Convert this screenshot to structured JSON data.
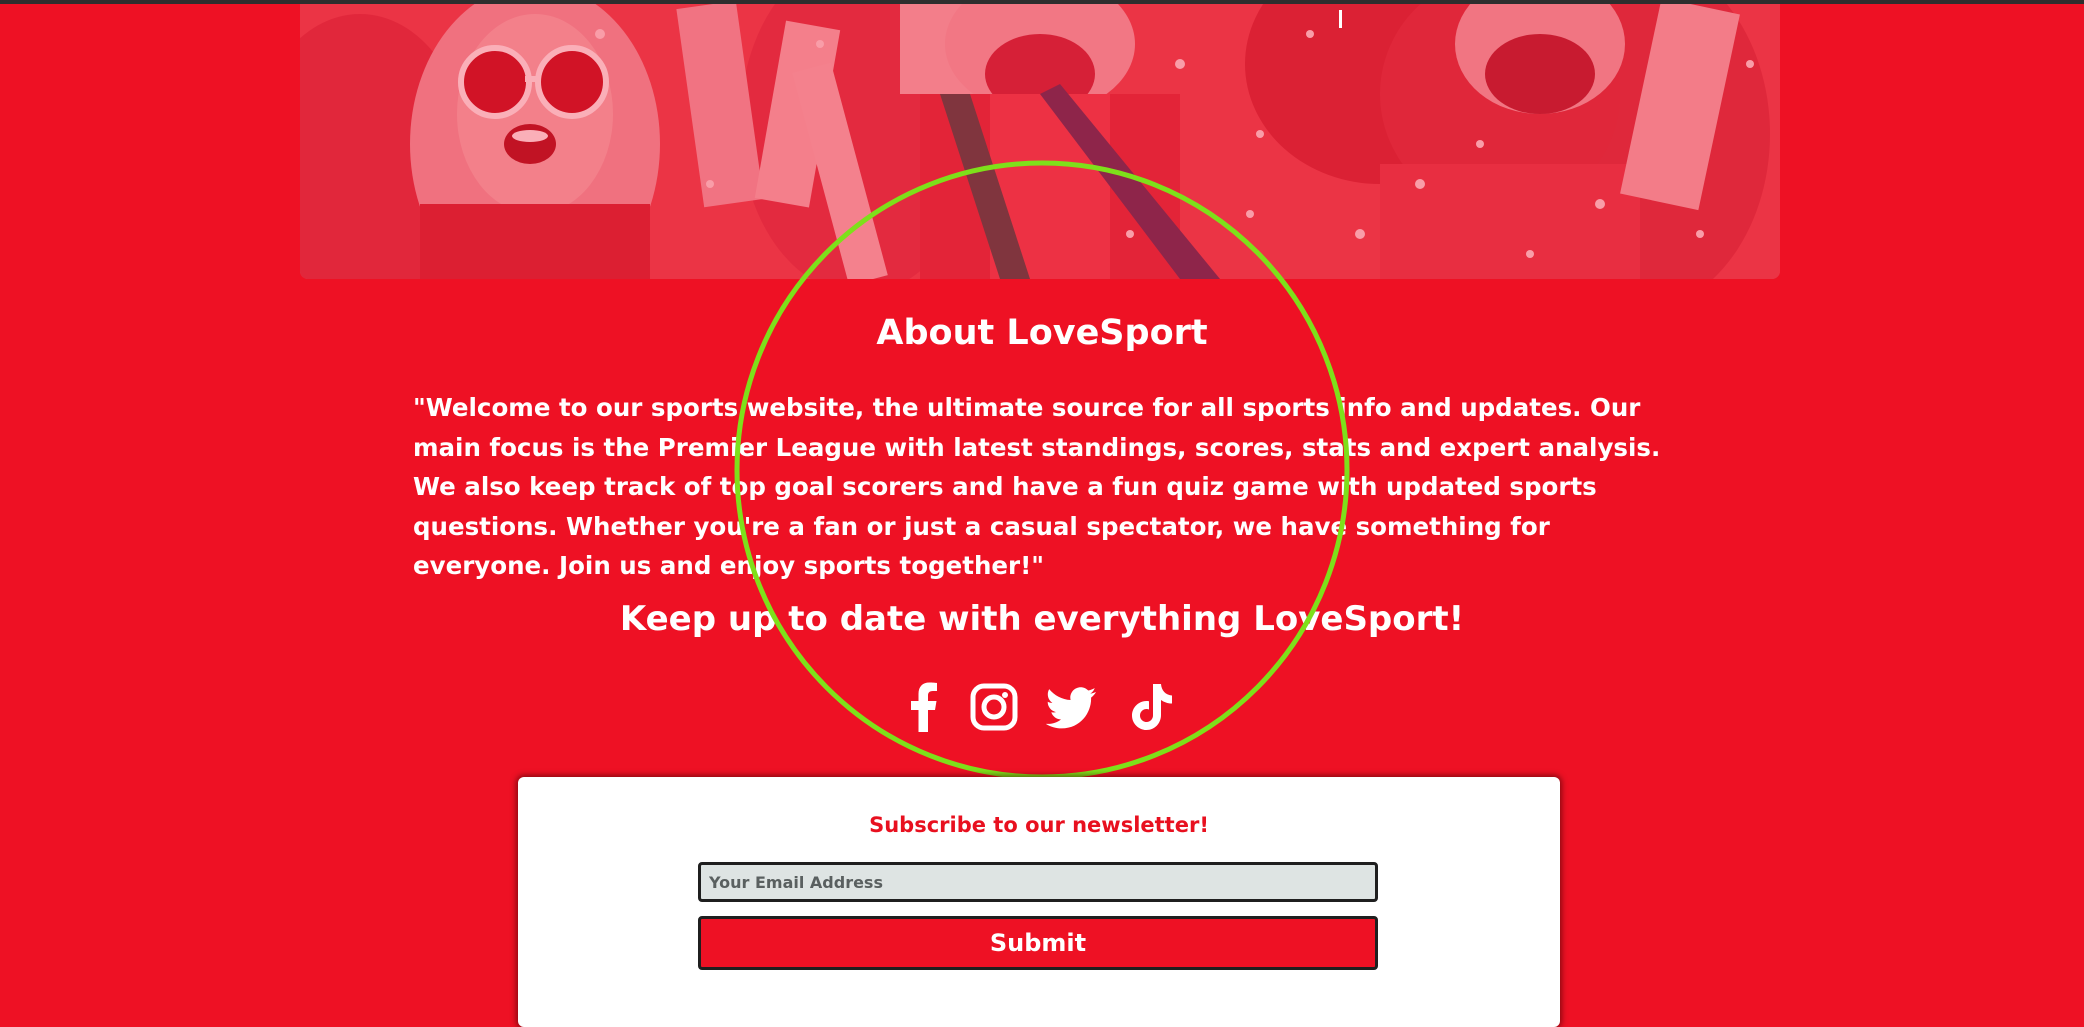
{
  "about": {
    "title": "About LoveSport",
    "description": "\"Welcome to our sports website, the ultimate source for all sports info and updates. Our main focus is the Premier League with latest standings, scores, stats and expert analysis. We also keep track of top goal scorers and have a fun quiz game with updated sports questions. Whether you're a fan or just a casual spectator, we have something for everyone. Join us and enjoy sports together!\""
  },
  "social": {
    "title": "Keep up to date with everything LoveSport!",
    "links": [
      {
        "icon": "facebook-icon"
      },
      {
        "icon": "instagram-icon"
      },
      {
        "icon": "twitter-icon"
      },
      {
        "icon": "tiktok-icon"
      }
    ]
  },
  "newsletter": {
    "title": "Subscribe to our newsletter!",
    "email_placeholder": "Your Email Address",
    "email_value": "",
    "submit_label": "Submit"
  },
  "colors": {
    "brand_red": "#ee1124",
    "newsletter_title": "#e8101f",
    "annotation_ring": "#7ee01a",
    "input_background": "#dee4e3"
  }
}
